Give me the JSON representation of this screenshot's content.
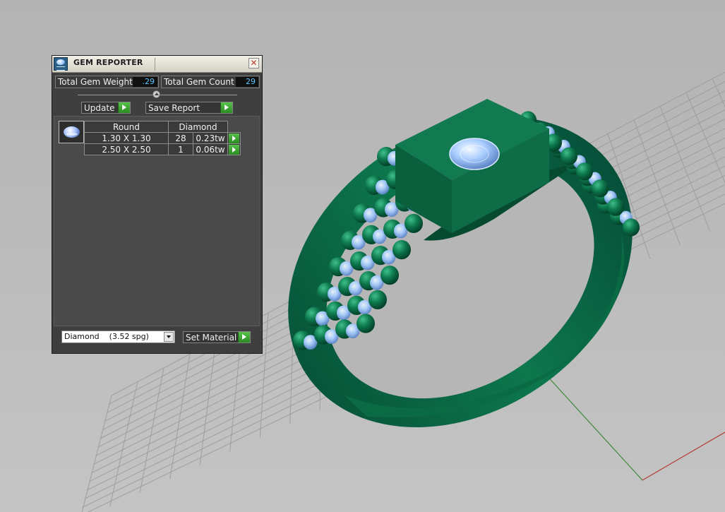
{
  "panel": {
    "title": "GEM REPORTER",
    "close_symbol": "✕",
    "total_weight_label": "Total Gem Weight",
    "total_weight_value": ".29",
    "total_count_label": "Total Gem Count",
    "total_count_value": "29",
    "update_label": "Update",
    "save_report_label": "Save Report",
    "table": {
      "shape": "Round",
      "material": "Diamond",
      "rows": [
        {
          "size": "1.30 X 1.30",
          "count": "28",
          "weight": "0.23tw"
        },
        {
          "size": "2.50 X 2.50",
          "count": "1",
          "weight": "0.06tw"
        }
      ]
    },
    "material_select_value": "Diamond    (3.52 spg)",
    "set_material_label": "Set Material"
  },
  "icons": {
    "app": "gem-reporter-icon",
    "close": "close-icon",
    "slider": "slider-knob-icon",
    "play": "play-arrow-icon",
    "thumbnail": "round-gem-icon",
    "dropdown": "chevron-down-icon"
  },
  "colors": {
    "ring_green": "#0b6b45",
    "gem_blue": "#9fc7ff",
    "viewport_bg": "#b9b9b9",
    "panel_bg": "#3f3f3f",
    "value_text": "#5fc7ff",
    "action_green": "#3fa836"
  }
}
